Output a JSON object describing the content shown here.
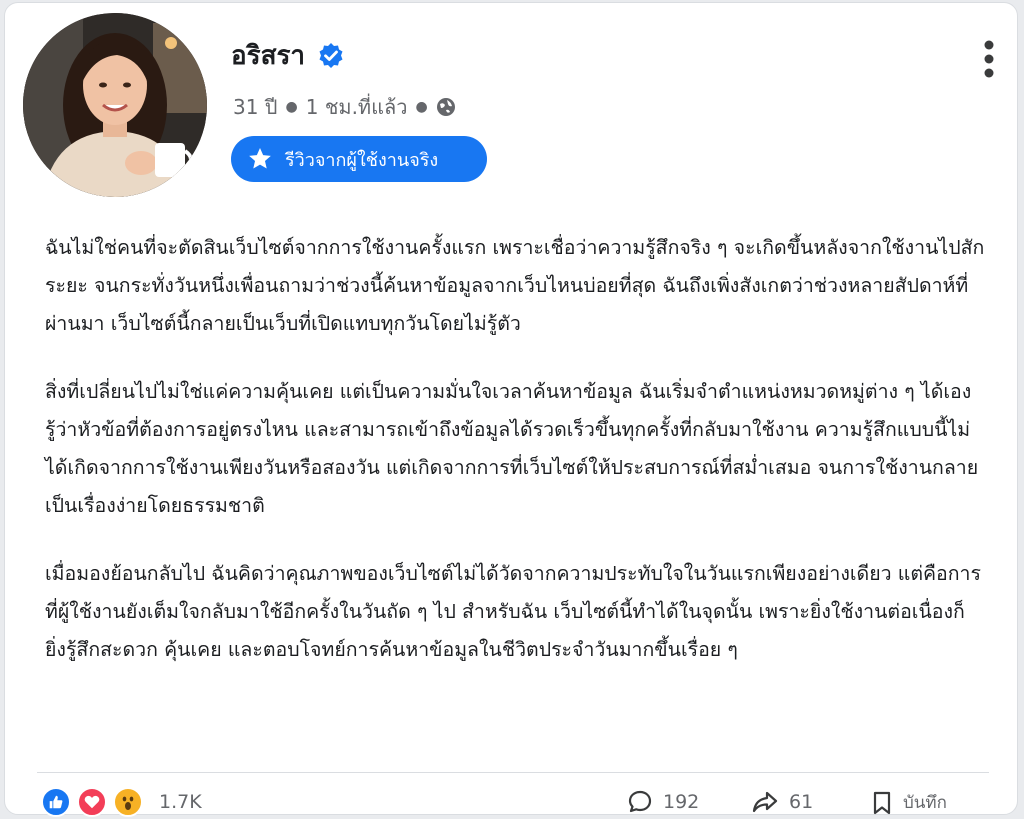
{
  "post": {
    "author": {
      "name": "อริสรา",
      "verified": true,
      "avatar_icon": "woman-with-coffee-cup-avatar"
    },
    "meta": {
      "age": "31 ปี",
      "time": "1 ชม.ที่แล้ว",
      "privacy_icon": "globe-icon"
    },
    "badge": {
      "label": "รีวิวจากผู้ใช้งานจริง",
      "icon": "star-icon"
    },
    "paragraphs": [
      "ฉันไม่ใช่คนที่จะตัดสินเว็บไซต์จากการใช้งานครั้งแรก เพราะเชื่อว่าความรู้สึกจริง ๆ จะเกิดขึ้นหลังจากใช้งานไปสักระยะ จนกระทั่งวันหนึ่งเพื่อนถามว่าช่วงนี้ค้นหาข้อมูลจากเว็บไหนบ่อยที่สุด ฉันถึงเพิ่งสังเกตว่าช่วงหลายสัปดาห์ที่ผ่านมา เว็บไซต์นี้กลายเป็นเว็บที่เปิดแทบทุกวันโดยไม่รู้ตัว",
      "สิ่งที่เปลี่ยนไปไม่ใช่แค่ความคุ้นเคย แต่เป็นความมั่นใจเวลาค้นหาข้อมูล ฉันเริ่มจำตำแหน่งหมวดหมู่ต่าง ๆ ได้เอง รู้ว่าหัวข้อที่ต้องการอยู่ตรงไหน และสามารถเข้าถึงข้อมูลได้รวดเร็วขึ้นทุกครั้งที่กลับมาใช้งาน ความรู้สึกแบบนี้ไม่ได้เกิดจากการใช้งานเพียงวันหรือสองวัน แต่เกิดจากการที่เว็บไซต์ให้ประสบการณ์ที่สม่ำเสมอ จนการใช้งานกลายเป็นเรื่องง่ายโดยธรรมชาติ",
      "เมื่อมองย้อนกลับไป ฉันคิดว่าคุณภาพของเว็บไซต์ไม่ได้วัดจากความประทับใจในวันแรกเพียงอย่างเดียว แต่คือการที่ผู้ใช้งานยังเต็มใจกลับมาใช้อีกครั้งในวันถัด ๆ ไป สำหรับฉัน เว็บไซต์นี้ทำได้ในจุดนั้น เพราะยิ่งใช้งานต่อเนื่องก็ยิ่งรู้สึกสะดวก คุ้นเคย และตอบโจทย์การค้นหาข้อมูลในชีวิตประจำวันมากขึ้นเรื่อย ๆ"
    ]
  },
  "footer": {
    "reactions": [
      "like-icon",
      "love-icon",
      "wow-icon"
    ],
    "reaction_count": "1.7K",
    "comments": "192",
    "shares": "61",
    "save_label": "บันทึก"
  },
  "colors": {
    "accent": "#1877f2",
    "love": "#f33e58",
    "wow": "#f7b125",
    "muted_text": "#65676b"
  }
}
